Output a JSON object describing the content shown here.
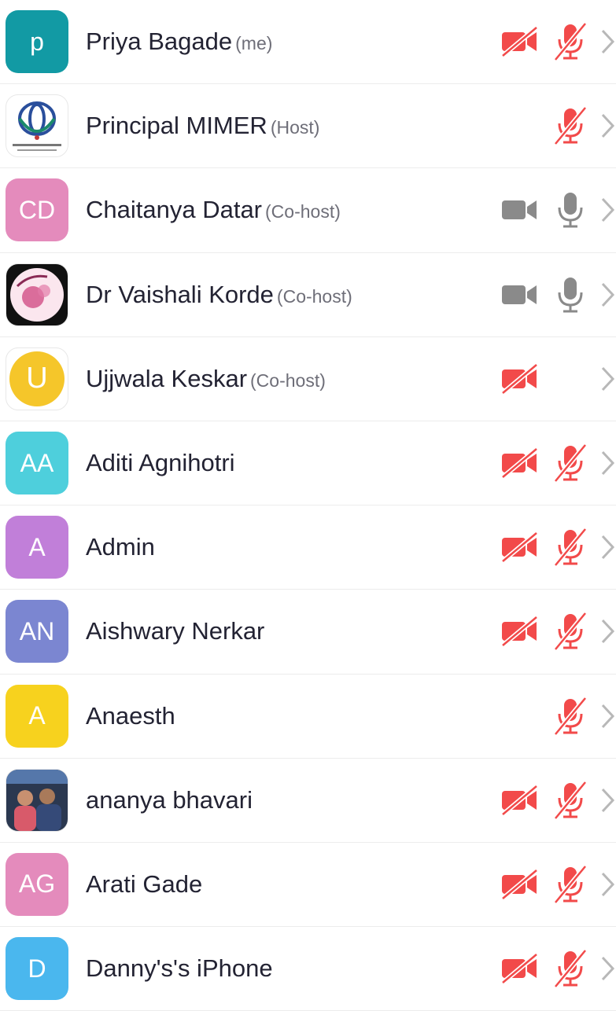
{
  "colors": {
    "muted": "#f24a4a",
    "active": "#8a8a8a",
    "chevron": "#b8b8b8",
    "name_text": "#232333",
    "role_text": "#6e6e78"
  },
  "participants": [
    {
      "name": "Priya Bagade",
      "role": "(me)",
      "avatar_type": "initials",
      "initials": "p",
      "avatar_color": "#129aa4",
      "video": "muted",
      "audio": "muted"
    },
    {
      "name": "Principal MIMER",
      "role": "(Host)",
      "avatar_type": "image",
      "image_desc": "lotus-logo",
      "video": "none",
      "audio": "muted"
    },
    {
      "name": "Chaitanya Datar",
      "role": "(Co-host)",
      "avatar_type": "initials",
      "initials": "CD",
      "avatar_color": "#e48bbc",
      "video": "on",
      "audio": "on"
    },
    {
      "name": "Dr Vaishali Korde",
      "role": "(Co-host)",
      "avatar_type": "image",
      "image_desc": "she-the-star-logo",
      "video": "on",
      "audio": "on"
    },
    {
      "name": "Ujjwala Keskar",
      "role": "(Co-host)",
      "avatar_type": "circle",
      "initials": "U",
      "avatar_color": "#f5c62a",
      "video": "muted",
      "audio": "none"
    },
    {
      "name": "Aditi Agnihotri",
      "role": "",
      "avatar_type": "initials",
      "initials": "AA",
      "avatar_color": "#4ecfdc",
      "video": "muted",
      "audio": "muted"
    },
    {
      "name": "Admin",
      "role": "",
      "avatar_type": "initials",
      "initials": "A",
      "avatar_color": "#c17fd9",
      "video": "muted",
      "audio": "muted"
    },
    {
      "name": "Aishwary Nerkar",
      "role": "",
      "avatar_type": "initials",
      "initials": "AN",
      "avatar_color": "#7b86d1",
      "video": "muted",
      "audio": "muted"
    },
    {
      "name": "Anaesth",
      "role": "",
      "avatar_type": "initials",
      "initials": "A",
      "avatar_color": "#f7d21e",
      "video": "none",
      "audio": "muted"
    },
    {
      "name": "ananya bhavari",
      "role": "",
      "avatar_type": "image",
      "image_desc": "couple-photo",
      "video": "muted",
      "audio": "muted"
    },
    {
      "name": "Arati Gade",
      "role": "",
      "avatar_type": "initials",
      "initials": "AG",
      "avatar_color": "#e48bbc",
      "video": "muted",
      "audio": "muted"
    },
    {
      "name": "Danny's's iPhone",
      "role": "",
      "avatar_type": "initials",
      "initials": "D",
      "avatar_color": "#4ab7ee",
      "video": "muted",
      "audio": "muted"
    }
  ]
}
